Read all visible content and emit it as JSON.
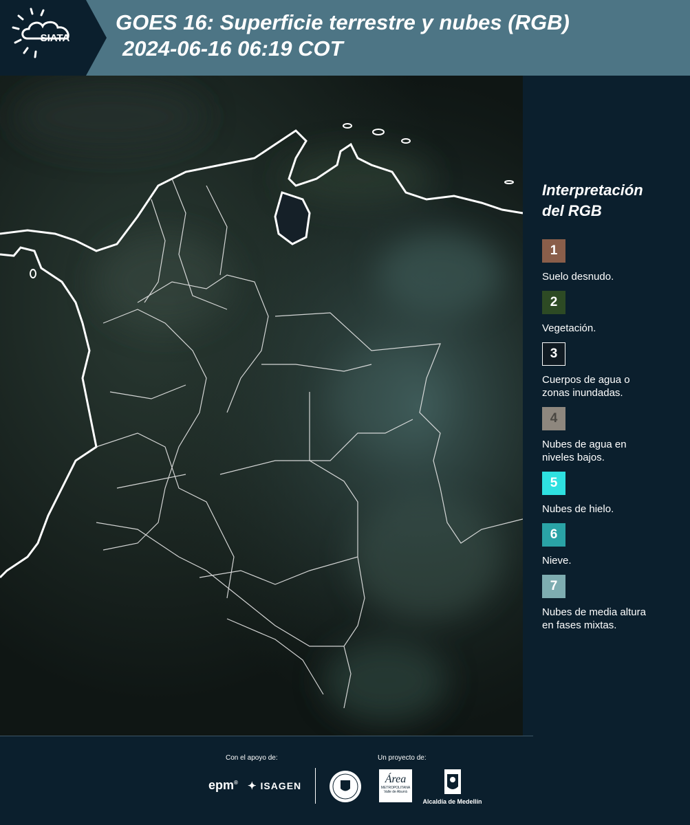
{
  "header": {
    "logo_text": "SIATA",
    "title_line1": "GOES 16: Superficie terrestre y nubes (RGB)",
    "title_line2": "2024-06-16 06:19 COT"
  },
  "legend": {
    "title_line1": "Interpretación",
    "title_line2": "del RGB",
    "items": [
      {
        "number": "1",
        "color": "#8a5e4a",
        "label_lines": [
          "Suelo desnudo."
        ]
      },
      {
        "number": "2",
        "color": "#2d4a24",
        "label_lines": [
          "Vegetación."
        ]
      },
      {
        "number": "3",
        "color": "#101a22",
        "label_lines": [
          "Cuerpos de agua o",
          "zonas inundadas."
        ]
      },
      {
        "number": "4",
        "color": "#8e877e",
        "label_lines": [
          "Nubes de agua en",
          "niveles bajos."
        ]
      },
      {
        "number": "5",
        "color": "#2ee0e0",
        "label_lines": [
          "Nubes de hielo."
        ]
      },
      {
        "number": "6",
        "color": "#2aa3a6",
        "label_lines": [
          "Nieve."
        ]
      },
      {
        "number": "7",
        "color": "#7eadb1",
        "label_lines": [
          "Nubes de media altura",
          "en fases mixtas."
        ]
      }
    ]
  },
  "footer": {
    "support_label": "Con el apoyo de:",
    "project_label": "Un proyecto de:",
    "epm": "epm",
    "isagen": "ISAGEN",
    "area_metro": "Área",
    "area_metro_sub1": "METROPOLITANA",
    "area_metro_sub2": "Valle de Aburrá",
    "alcaldia": "Alcaldía de Medellín"
  }
}
